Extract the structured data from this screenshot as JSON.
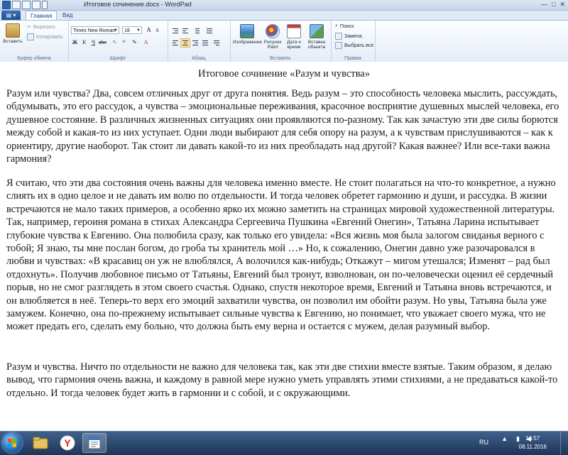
{
  "window": {
    "title": "Итоговое сочинение.docx - WordPad",
    "controls": [
      "—",
      "□",
      "✕"
    ]
  },
  "tabs": [
    {
      "label": "Главная",
      "active": true
    },
    {
      "label": "Вид",
      "active": false
    }
  ],
  "ribbon": {
    "clipboard": {
      "label": "Буфер обмена",
      "paste": "Вставить",
      "cut": "Вырезать",
      "copy": "Копировать"
    },
    "font": {
      "label": "Шрифт",
      "family": "Times New Roman",
      "size": "18"
    },
    "paragraph": {
      "label": "Абзац",
      "active_alignment": "center"
    },
    "insert": {
      "label": "Вставить",
      "image": "Изображение",
      "paint_line1": "Рисунок",
      "paint_line2": "Paint",
      "datetime_line1": "Дата и",
      "datetime_line2": "время",
      "object_line1": "Вставка",
      "object_line2": "объекта"
    },
    "editing": {
      "label": "Правка",
      "find": "Поиск",
      "replace": "Замена",
      "select_all": "Выбрать все"
    }
  },
  "document": {
    "title": "Итоговое сочинение «Разум и чувства»",
    "paragraphs": [
      "Разум или чувства? Два, совсем отличных друг от друга понятия. Ведь разум – это способность человека мыслить, рассуждать, обдумывать, это его рассудок, а чувства – эмоциональные переживания, красочное восприятие душевных мыслей человека, его душевное состояние. В различных жизненных ситуациях они проявляются по-разному. Так как зачастую эти две силы борются между собой и какая-то из них уступает. Одни люди выбирают для себя опору на разум, а к чувствам прислушиваются – как к ориентиру, другие наоборот. Так стоит ли давать какой-то из них преобладать над другой? Какая важнее? Или все-таки важна гармония?",
      "Я считаю, что эти два состояния очень важны для человека именно вместе. Не стоит полагаться на что-то конкретное, а нужно слиять их в одно целое и не давать им волю по отдельности. И тогда человек обретет гармонию и души, и рассудка. В жизни встречаются не мало таких примеров, а особенно ярко их можно заметить на страницах мировой художественной литературы. Так, например, героиня романа в стихах Александра Сергеевича Пушкина «Евгений Онегин», Татьяна Ларина испытывает глубокие чувства к Евгению. Она полюбила сразу, как только его увидела: «Вся жизнь моя была залогом свиданья верного с тобой; Я знаю, ты мне послан богом, до гроба ты хранитель мой …» Но, к сожалению, Онегин давно уже разочаровался в любви и чувствах: «В красавиц он уж не влюблялся, А волочился как-нибудь; Откажут – мигом утешался; Изменят – рад был отдохнуть». Получив любовное письмо от Татьяны, Евгений был тронут, взволнован, он по-человечески оценил её сердечный порыв, но не смог разглядеть в этом своего счастья. Однако, спустя некоторое время, Евгений и Татьяна вновь встречаются, и он влюбляется в неё. Теперь-то верх его эмоций захватили чувства, он позволил им обойти разум. Но увы, Татьяна была уже замужем. Конечно, она по-прежнему испытывает сильные чувства к Евгению, но понимает, что уважает своего мужа, что не может предать его, сделать ему больно, что должна быть ему верна и остается с мужем, делая разумный выбор.",
      "Разум и чувства. Ничто по отдельности не важно для человека так, как эти две стихии вместе взятые. Таким образом, я делаю вывод, что гармония очень важна, и каждому в равной мере нужно уметь управлять этими стихиями, а не предаваться какой-то отдельно. И тогда человек будет жить в гармонии и с собой, и с окружающими."
    ]
  },
  "taskbar": {
    "language": "RU",
    "time": "16:57",
    "date": "08.11.2016",
    "apps": [
      "explorer-icon",
      "yandex-browser-icon",
      "wordpad-icon"
    ]
  },
  "colors": {
    "accent": "#1f4f92",
    "ribbon_bg": "#e3ecf7",
    "taskbar": "#1d3557"
  }
}
